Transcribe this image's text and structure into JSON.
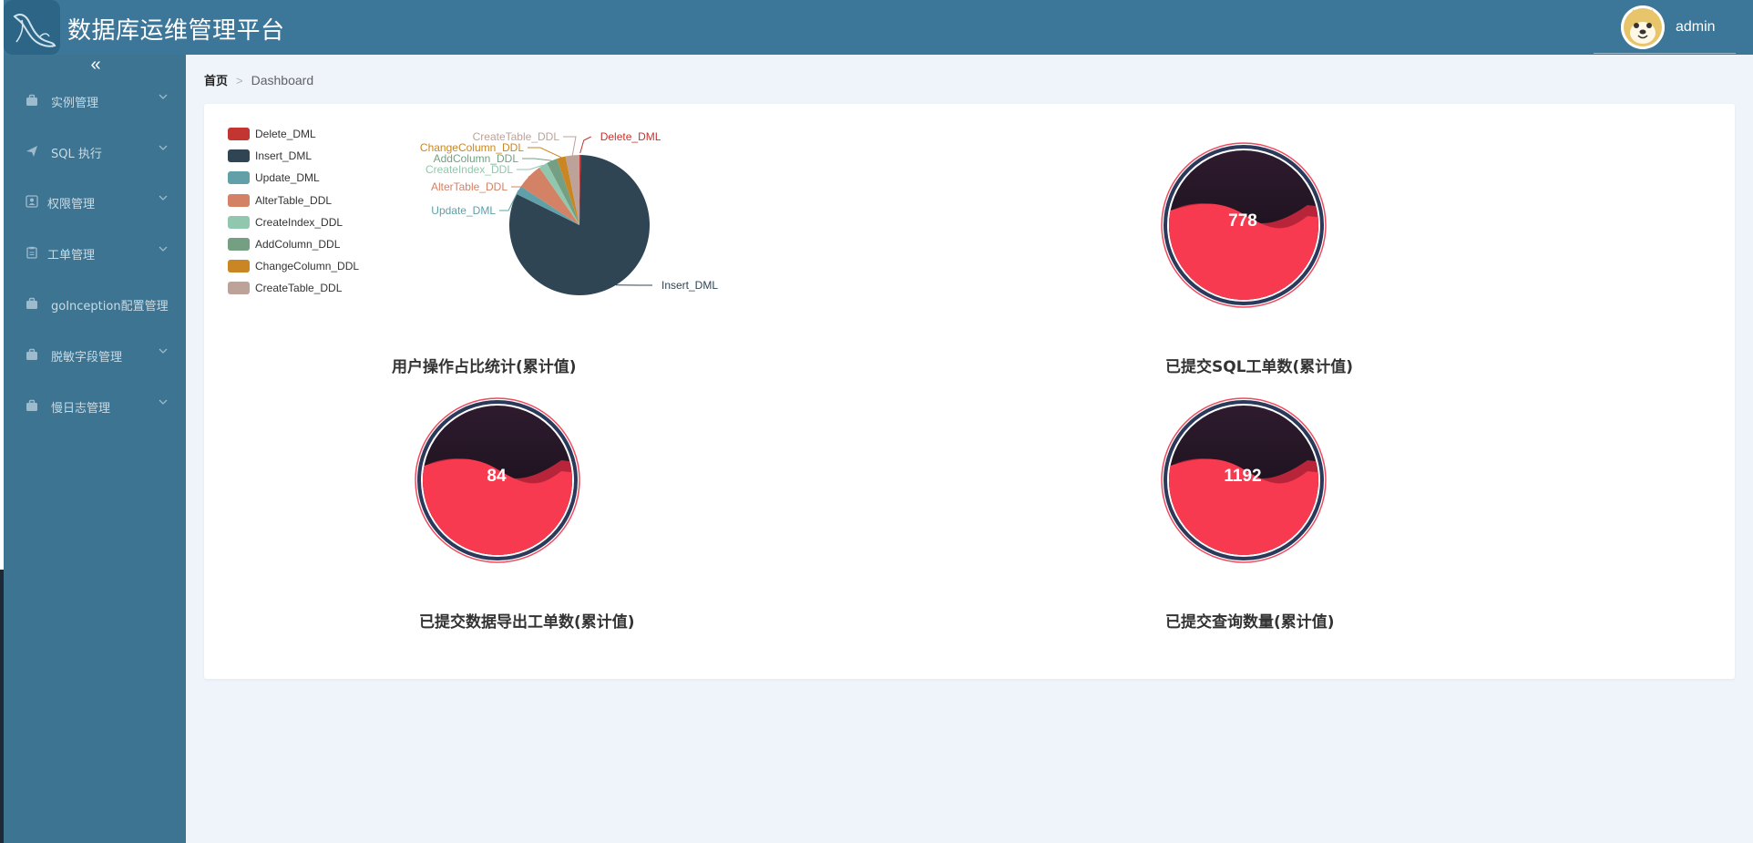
{
  "app": {
    "title": "数据库运维管理平台"
  },
  "user": {
    "name": "admin"
  },
  "sidebar": {
    "items": [
      {
        "label": "实例管理",
        "icon": "briefcase-icon"
      },
      {
        "label": "SQL 执行",
        "icon": "paper-plane-icon"
      },
      {
        "label": "权限管理",
        "icon": "user-card-icon"
      },
      {
        "label": "工单管理",
        "icon": "clipboard-icon"
      },
      {
        "label": "goInception配置管理",
        "icon": "briefcase-icon"
      },
      {
        "label": "脱敏字段管理",
        "icon": "briefcase-icon"
      },
      {
        "label": "慢日志管理",
        "icon": "briefcase-icon"
      }
    ]
  },
  "breadcrumb": {
    "home": "首页",
    "current": "Dashboard"
  },
  "pie_title": "用户操作占比统计(累计值)",
  "gauges": [
    {
      "title": "已提交SQL工单数(累计值)",
      "value": "778"
    },
    {
      "title": "已提交数据导出工单数(累计值)",
      "value": "84"
    },
    {
      "title": "已提交查询数量(累计值)",
      "value": "1192"
    }
  ],
  "colors": {
    "header": "#3c7698",
    "sidebar": "#3c7491",
    "gauge_fill": "#f73a4f",
    "gauge_dark": "#1f1423"
  },
  "chart_data": [
    {
      "type": "pie",
      "title": "用户操作占比统计(累计值)",
      "legend_position": "top-left",
      "categories": [
        "Delete_DML",
        "Insert_DML",
        "Update_DML",
        "AlterTable_DDL",
        "CreateIndex_DDL",
        "AddColumn_DDL",
        "ChangeColumn_DDL",
        "CreateTable_DDL"
      ],
      "values": [
        0.3,
        82,
        2,
        6,
        2,
        2.5,
        2,
        3.2
      ],
      "colors": [
        "#c23531",
        "#2f4554",
        "#61a0a8",
        "#d48265",
        "#91c7ae",
        "#749f83",
        "#ca8622",
        "#bda29a"
      ]
    }
  ]
}
